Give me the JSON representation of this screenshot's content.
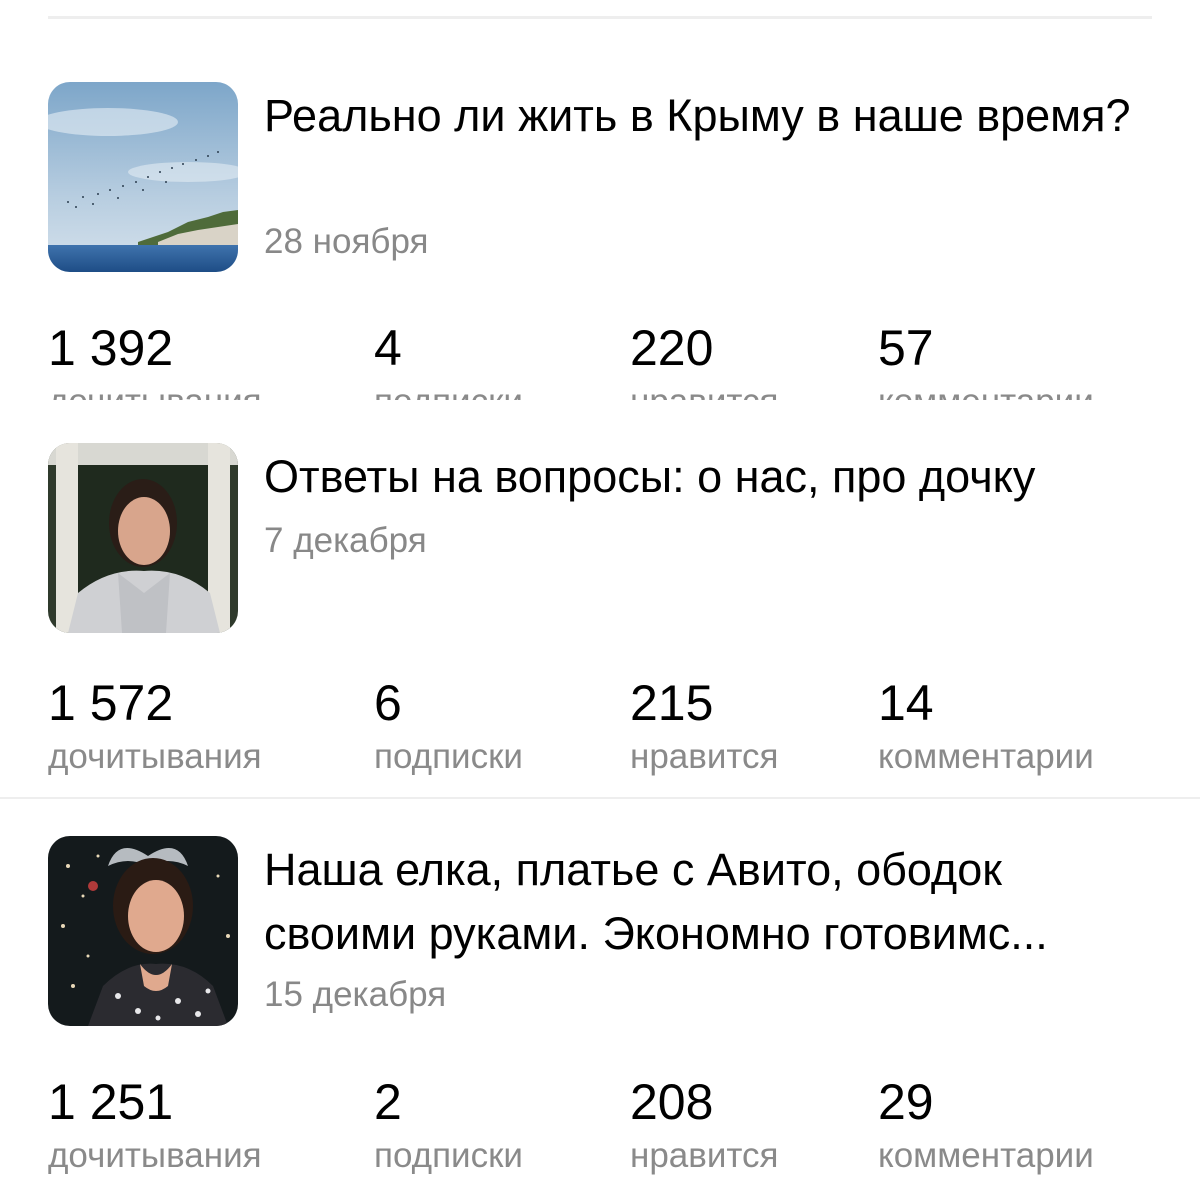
{
  "articles": [
    {
      "title": "Реально ли жить в Крыму в наше время?",
      "date": "28 ноября",
      "thumbnail": "sea-coast-photo",
      "stats": [
        {
          "value": "1 392",
          "label": "дочитывания"
        },
        {
          "value": "4",
          "label": "подписки"
        },
        {
          "value": "220",
          "label": "нравится"
        },
        {
          "value": "57",
          "label": "комментарии"
        }
      ]
    },
    {
      "title": "Ответы на вопросы: о нас, про дочку",
      "date": "7 декабря",
      "thumbnail": "woman-portrait-photo",
      "stats": [
        {
          "value": "1 572",
          "label": "дочитывания"
        },
        {
          "value": "6",
          "label": "подписки"
        },
        {
          "value": "215",
          "label": "нравится"
        },
        {
          "value": "14",
          "label": "комментарии"
        }
      ]
    },
    {
      "title": "Наша елка, платье с Авито, ободок своими руками. Экономно готовимс...",
      "date": "15 декабря",
      "thumbnail": "woman-christmas-tree-photo",
      "stats": [
        {
          "value": "1 251",
          "label": "дочитывания"
        },
        {
          "value": "2",
          "label": "подписки"
        },
        {
          "value": "208",
          "label": "нравится"
        },
        {
          "value": "29",
          "label": "комментарии"
        }
      ]
    }
  ],
  "colors": {
    "title": "#000000",
    "date": "#888888",
    "stat_label": "#8a8a8a",
    "divider": "#eeeeee"
  }
}
